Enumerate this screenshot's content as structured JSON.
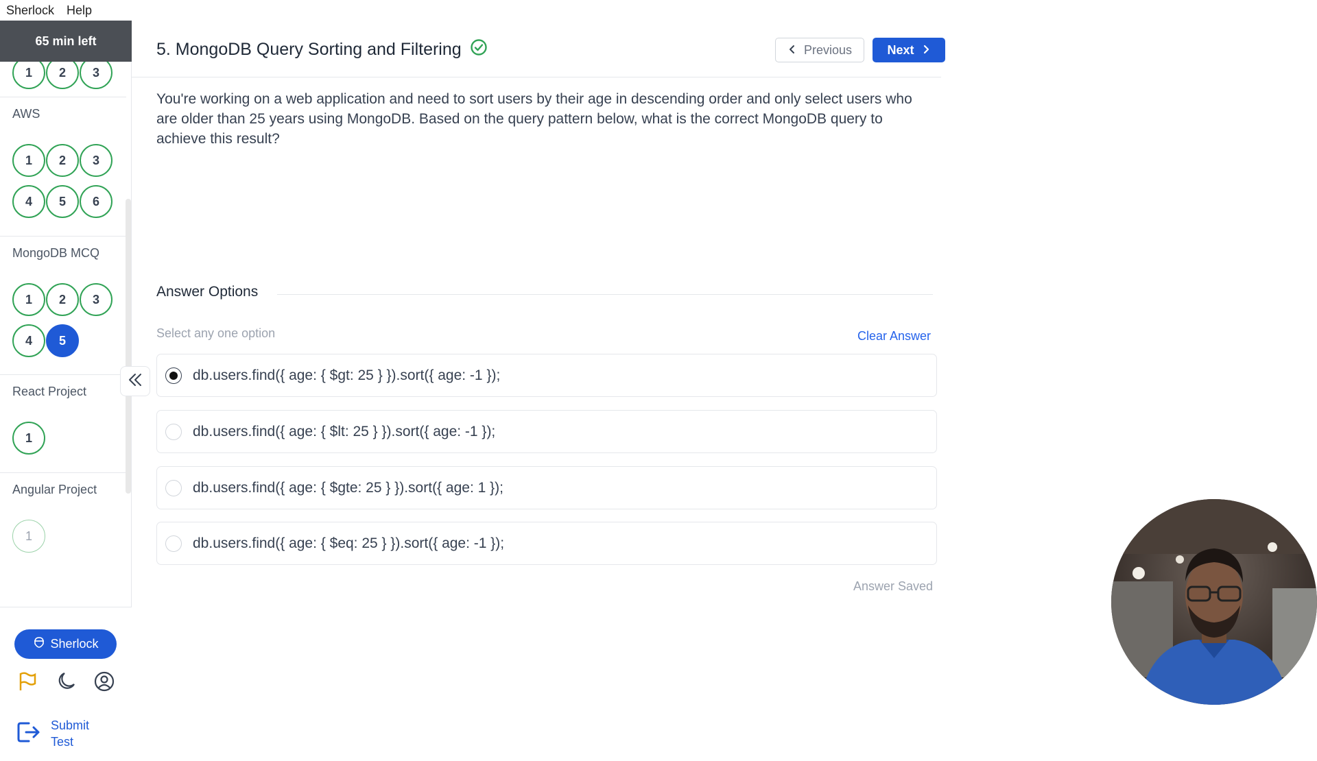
{
  "menubar": {
    "app": "Sherlock",
    "help": "Help"
  },
  "sidebar": {
    "timer": "65 min left",
    "sections": [
      {
        "title": "",
        "questions": [
          "1",
          "2",
          "3"
        ],
        "states": [
          "answered",
          "answered",
          "answered"
        ]
      },
      {
        "title": "AWS",
        "questions": [
          "1",
          "2",
          "3",
          "4",
          "5",
          "6"
        ],
        "states": [
          "answered",
          "answered",
          "answered",
          "answered",
          "answered",
          "answered"
        ]
      },
      {
        "title": "MongoDB MCQ",
        "questions": [
          "1",
          "2",
          "3",
          "4",
          "5"
        ],
        "states": [
          "answered",
          "answered",
          "answered",
          "answered",
          "current"
        ]
      },
      {
        "title": "React Project",
        "questions": [
          "1"
        ],
        "states": [
          "answered"
        ]
      },
      {
        "title": "Angular Project",
        "questions": [
          "1"
        ],
        "states": [
          "pending"
        ]
      }
    ],
    "sherlock_button": "Sherlock",
    "submit_label": "Submit Test"
  },
  "question": {
    "title": "5. MongoDB Query Sorting and Filtering",
    "text": "You're working on a web application and need to sort users by their age in descending order and only select users who are older than 25 years using MongoDB. Based on the query pattern below, what is the correct MongoDB query to achieve this result?",
    "prev_label": "Previous",
    "next_label": "Next"
  },
  "answers": {
    "heading": "Answer Options",
    "hint": "Select any one option",
    "clear_label": "Clear Answer",
    "options": [
      "db.users.find({ age: { $gt: 25 } }).sort({ age: -1 });",
      "db.users.find({ age: { $lt: 25 } }).sort({ age: -1 });",
      "db.users.find({ age: { $gte: 25 } }).sort({ age: 1 });",
      "db.users.find({ age: { $eq: 25 } }).sort({ age: -1 });"
    ],
    "selected_index": 0,
    "status": "Answer Saved"
  },
  "colors": {
    "accent": "#1f5ad6",
    "answered": "#31a356",
    "flag": "#e3a008"
  },
  "icons": [
    "collapse-double-chevron-icon",
    "flag-icon",
    "moon-icon",
    "user-circle-icon",
    "logout-icon",
    "check-circle-icon",
    "sherlock-logo-icon"
  ]
}
